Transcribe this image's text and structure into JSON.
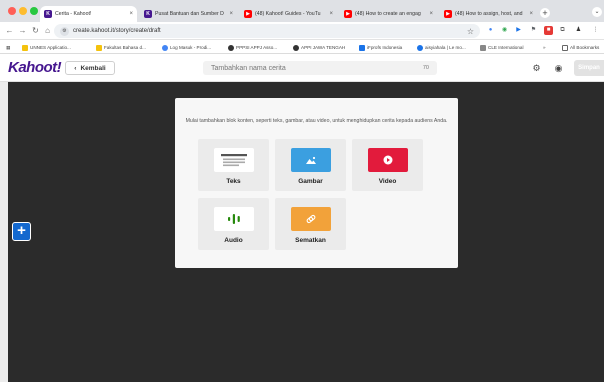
{
  "browser": {
    "tabs": [
      {
        "title": "Cerita - Kahoot!",
        "favicon": "kahoot-icon",
        "color": "#46178f",
        "active": true
      },
      {
        "title": "Pusat Bantuan dan Sumber D",
        "favicon": "kahoot-icon",
        "color": "#46178f",
        "active": false
      },
      {
        "title": "(48) Kahoot! Guides - YouTu",
        "favicon": "youtube-icon",
        "color": "#ff0000",
        "active": false
      },
      {
        "title": "(48) How to create an engag",
        "favicon": "youtube-icon",
        "color": "#ff0000",
        "active": false
      },
      {
        "title": "(48) How to assign, host, and",
        "favicon": "youtube-icon",
        "color": "#ff0000",
        "active": false
      }
    ],
    "url": "create.kahoot.it/story/create/draft",
    "bookmarks": [
      {
        "label": "UNNES Applicatio...",
        "color": "#f4c20d"
      },
      {
        "label": "Fakultas Bahasa d...",
        "color": "#f4c20d"
      },
      {
        "label": "Log Masuk - Prodi...",
        "color": "#4285f4"
      },
      {
        "label": "PPPSI APPJ Asso...",
        "color": "#333333"
      },
      {
        "label": "APPI JAWA TENGAH",
        "color": "#333333"
      },
      {
        "label": "iFprofs Indonesia",
        "color": "#1a73e8"
      },
      {
        "label": "aisyiahala | Le mo...",
        "color": "#1a73e8"
      },
      {
        "label": "CLE International",
        "color": "#888888"
      }
    ],
    "bookmarks_more": "»",
    "all_bookmarks": "All Bookmarks"
  },
  "kahoot": {
    "logo": "Kahoot!",
    "back_label": "Kembali",
    "title_placeholder": "Tambahkan nama cerita",
    "title_counter": "70",
    "save_label": "Simpan"
  },
  "picker": {
    "hint": "Mulai tambahkan blok konten, seperti teks, gambar, atau video, untuk menghidupkan cerita kepada audiens Anda.",
    "items": [
      {
        "label": "Teks",
        "icon": "text-icon",
        "color": "#ffffff"
      },
      {
        "label": "Gambar",
        "icon": "image-icon",
        "color": "#3b9fe0"
      },
      {
        "label": "Video",
        "icon": "video-icon",
        "color": "#e21b3c"
      },
      {
        "label": "Audio",
        "icon": "audio-icon",
        "color": "#ffffff"
      },
      {
        "label": "Sematkan",
        "icon": "embed-icon",
        "color": "#f2a23a"
      }
    ]
  },
  "colors": {
    "brand": "#46178f",
    "add_button": "#1368ce",
    "canvas": "#2b2b2b",
    "audio_bars": "#26890c"
  }
}
